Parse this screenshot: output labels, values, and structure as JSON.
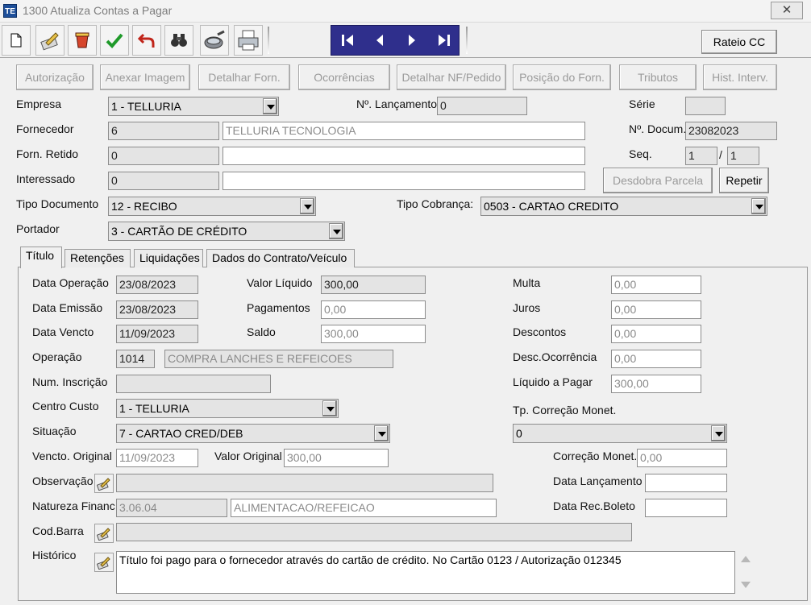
{
  "window": {
    "title": "1300 Atualiza Contas a Pagar",
    "app_icon_text": "TE",
    "close_symbol": "✕"
  },
  "toolbar": {
    "icons": [
      "new-document-icon",
      "edit-icon",
      "delete-icon",
      "confirm-check-icon",
      "undo-icon",
      "search-binoculars-icon",
      "view-icon",
      "print-icon"
    ],
    "nav_icons": [
      "first-record-icon",
      "previous-record-icon",
      "next-record-icon",
      "last-record-icon"
    ],
    "rateio_label": "Rateio CC"
  },
  "actions": {
    "autorizacao": "Autorização",
    "anexar_imagem": "Anexar Imagem",
    "detalhar_forn": "Detalhar Forn.",
    "ocorrencias": "Ocorrências",
    "detalhar_nf": "Detalhar NF/Pedido",
    "posicao_forn": "Posição do Forn.",
    "tributos": "Tributos",
    "hist_interv": "Hist. Interv."
  },
  "header": {
    "empresa_label": "Empresa",
    "empresa_value": "1 - TELLURIA",
    "lancamento_label": "Nº. Lançamento",
    "lancamento_value": "0",
    "serie_label": "Série",
    "serie_value": "",
    "fornecedor_label": "Fornecedor",
    "fornecedor_code": "6",
    "fornecedor_name": "TELLURIA TECNOLOGIA",
    "docum_label": "Nº. Docum.",
    "docum_value": "23082023",
    "forn_retido_label": "Forn. Retido",
    "forn_retido_code": "0",
    "forn_retido_name": "",
    "seq_label": "Seq.",
    "seq_value": "1",
    "seq_sep": "/",
    "seq_total": "1",
    "interessado_label": "Interessado",
    "interessado_code": "0",
    "interessado_name": "",
    "desdobra_label": "Desdobra Parcela",
    "repetir_label": "Repetir",
    "tipo_documento_label": "Tipo Documento",
    "tipo_documento_value": "12 - RECIBO",
    "tipo_cobranca_label": "Tipo Cobrança:",
    "tipo_cobranca_value": "0503 - CARTAO CREDITO",
    "portador_label": "Portador",
    "portador_value": "3 - CARTÃO DE CRÉDITO"
  },
  "tabs": [
    "Título",
    "Retenções",
    "Liquidações",
    "Dados do Contrato/Veículo"
  ],
  "titulo": {
    "data_operacao_label": "Data Operação",
    "data_operacao": "23/08/2023",
    "data_emissao_label": "Data Emissão",
    "data_emissao": "23/08/2023",
    "data_vencto_label": "Data Vencto",
    "data_vencto": "11/09/2023",
    "operacao_label": "Operação",
    "operacao_code": "1014",
    "operacao_desc": "COMPRA LANCHES E REFEICOES",
    "num_inscricao_label": "Num. Inscrição",
    "num_inscricao": "",
    "centro_custo_label": "Centro Custo",
    "centro_custo": "1 - TELLURIA",
    "situacao_label": "Situação",
    "situacao": "7 - CARTAO CRED/DEB",
    "vencto_original_label": "Vencto. Original",
    "vencto_original": "11/09/2023",
    "valor_original_label": "Valor Original",
    "valor_original": "300,00",
    "valor_liquido_label": "Valor Líquido",
    "valor_liquido": "300,00",
    "pagamentos_label": "Pagamentos",
    "pagamentos": "0,00",
    "saldo_label": "Saldo",
    "saldo": "300,00",
    "multa_label": "Multa",
    "multa": "0,00",
    "juros_label": "Juros",
    "juros": "0,00",
    "descontos_label": "Descontos",
    "descontos": "0,00",
    "desc_ocorrencia_label": "Desc.Ocorrência",
    "desc_ocorrencia": "0,00",
    "liquido_pagar_label": "Líquido a Pagar",
    "liquido_pagar": "300,00",
    "tp_correcao_label": "Tp. Correção Monet.",
    "tp_correcao": "0",
    "correcao_monet_label": "Correção Monet.",
    "correcao_monet": "0,00",
    "observacao_label": "Observação",
    "observacao": "",
    "data_lancamento_label": "Data Lançamento",
    "data_lancamento": "",
    "natureza_label": "Natureza Financ.",
    "natureza_code": "3.06.04",
    "natureza_desc": "ALIMENTACAO/REFEICAO",
    "data_rec_boleto_label": "Data Rec.Boleto",
    "data_rec_boleto": "",
    "cod_barra_label": "Cod.Barra",
    "cod_barra": "",
    "historico_label": "Histórico",
    "historico": "Título foi pago para o fornecedor através do cartão de crédito. No Cartão 0123 / Autorização 012345"
  }
}
